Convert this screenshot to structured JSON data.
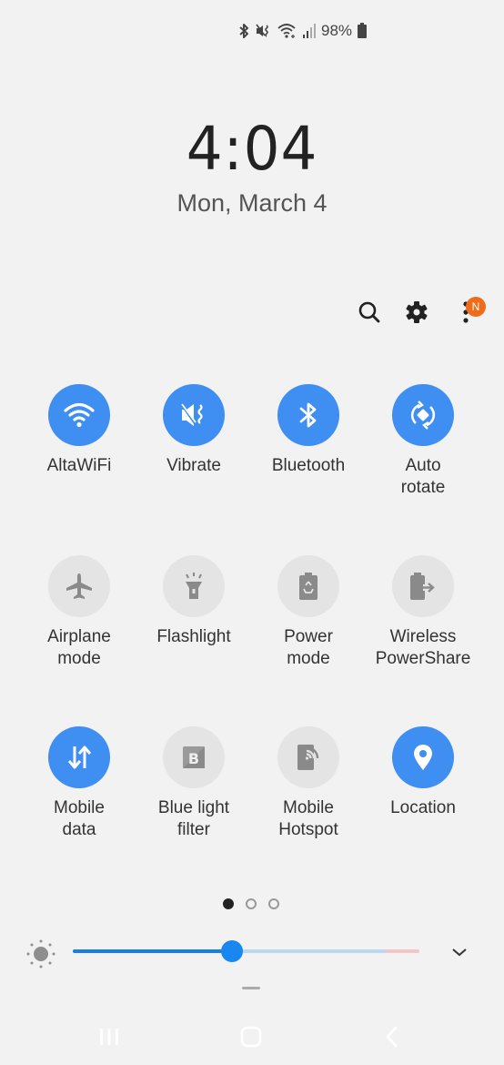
{
  "status_bar": {
    "icons": [
      "bluetooth-icon",
      "vibrate-icon",
      "wifi-icon",
      "signal-icon",
      "battery-icon"
    ],
    "battery_percent": "98%"
  },
  "clock": {
    "time": "4:04",
    "date": "Mon, March 4"
  },
  "top_actions": {
    "search": "search-icon",
    "settings": "gear-icon",
    "more": "more-vert-icon",
    "notification_badge": "N"
  },
  "tiles": [
    {
      "label": "AltaWiFi",
      "icon": "wifi-icon",
      "on": true
    },
    {
      "label": "Vibrate",
      "icon": "vibrate-icon",
      "on": true
    },
    {
      "label": "Bluetooth",
      "icon": "bluetooth-icon",
      "on": true
    },
    {
      "label": "Auto\nrotate",
      "icon": "auto-rotate-icon",
      "on": true
    },
    {
      "label": "Airplane\nmode",
      "icon": "airplane-icon",
      "on": false
    },
    {
      "label": "Flashlight",
      "icon": "flashlight-icon",
      "on": false
    },
    {
      "label": "Power\nmode",
      "icon": "power-mode-icon",
      "on": false
    },
    {
      "label": "Wireless\nPowerShare",
      "icon": "wireless-powershare-icon",
      "on": false
    },
    {
      "label": "Mobile\ndata",
      "icon": "mobile-data-icon",
      "on": true
    },
    {
      "label": "Blue light\nfilter",
      "icon": "blue-light-filter-icon",
      "on": false
    },
    {
      "label": "Mobile\nHotspot",
      "icon": "mobile-hotspot-icon",
      "on": false
    },
    {
      "label": "Location",
      "icon": "location-icon",
      "on": true
    }
  ],
  "pager": {
    "total": 3,
    "current": 1
  },
  "brightness": {
    "level_percent": 46
  },
  "colors": {
    "accent": "#3f8ef1",
    "slider_fill": "#1a7ee6",
    "badge": "#ef6c1a",
    "nav_bar": "#241c22"
  },
  "nav": {
    "recents": "recents-icon",
    "home": "home-icon",
    "back": "back-icon"
  }
}
